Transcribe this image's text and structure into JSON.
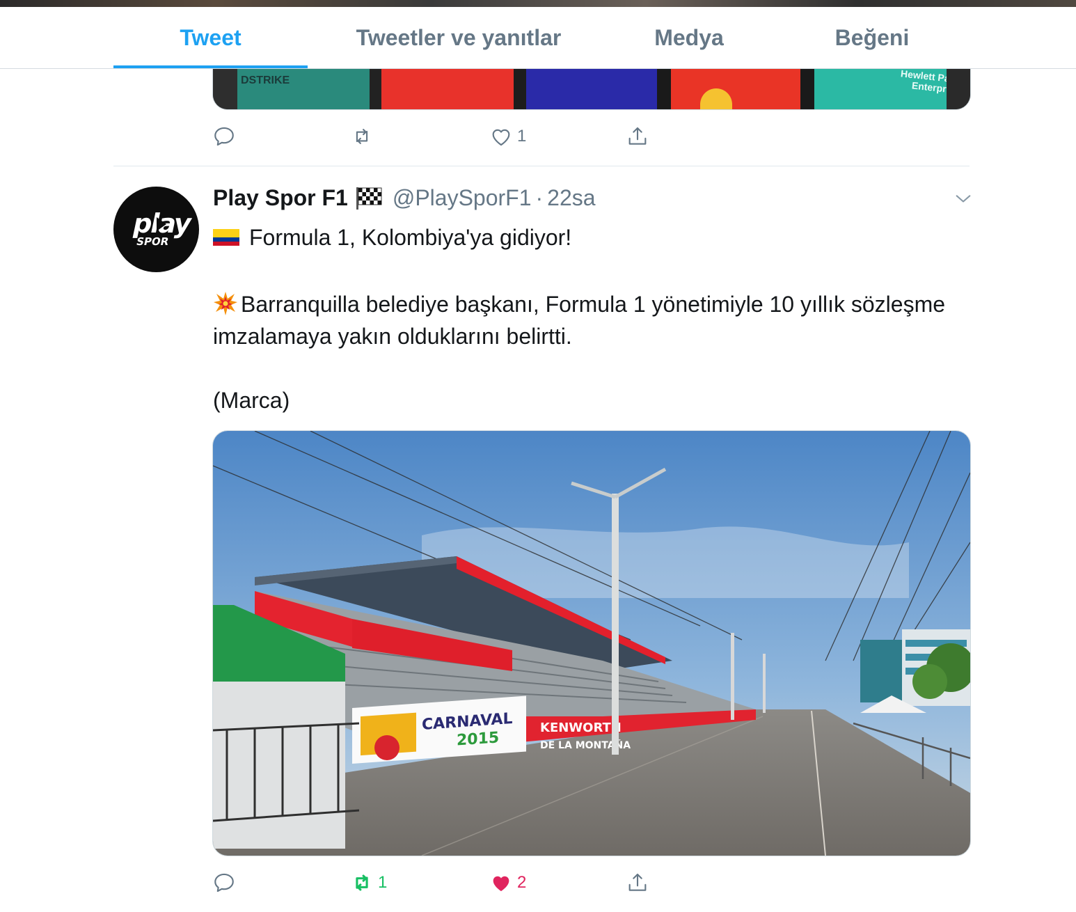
{
  "tabs": [
    {
      "label": "Tweet",
      "active": true
    },
    {
      "label": "Tweetler ve yanıtlar",
      "active": false
    },
    {
      "label": "Medya",
      "active": false
    },
    {
      "label": "Beğeni",
      "active": false
    }
  ],
  "previous_tweet": {
    "media_labels": [
      "DSTRIKE",
      "Hewlett Pa",
      "Enterpr"
    ],
    "actions": {
      "reply_count": "",
      "retweet_count": "",
      "like_count": "1",
      "share": ""
    }
  },
  "tweet": {
    "author_name": "Play Spor F1",
    "author_name_icon": "checkered-flag-icon",
    "handle": "@PlaySporF1",
    "separator": "·",
    "time": "22sa",
    "avatar_logo": {
      "top": "play",
      "bottom": "SPOR"
    },
    "lines": [
      {
        "emoji": "colombia-flag-icon",
        "text": "Formula 1, Kolombiya'ya gidiyor!"
      },
      {
        "emoji": "collision-icon",
        "text": "Barranquilla belediye başkanı, Formula 1 yönetimiyle 10 yıllık sözleşme imzalamaya yakın olduklarını belirtti."
      },
      {
        "emoji": "",
        "text": "(Marca)"
      }
    ],
    "media": {
      "description_icons": [
        "street-photo"
      ],
      "banner_texts": [
        "CARNAVAL",
        "2015",
        "KENWORTH",
        "DE LA MONTAÑA"
      ]
    },
    "actions": {
      "reply_count": "",
      "retweet_count": "1",
      "like_count": "2",
      "liked": true,
      "retweeted": true
    }
  },
  "colors": {
    "accent": "#1da1f2",
    "muted": "#657786",
    "retweet_green": "#17bf63",
    "like_red": "#e0245e"
  }
}
